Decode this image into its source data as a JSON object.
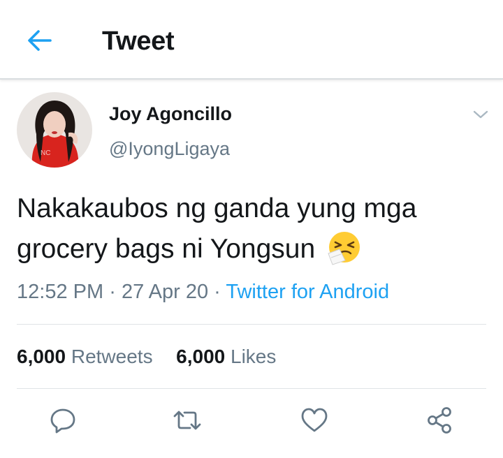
{
  "header": {
    "back_icon": "arrow-left-icon",
    "title": "Tweet"
  },
  "tweet": {
    "author_name": "Joy Agoncillo",
    "author_handle": "@IyongLigaya",
    "text": "Nakakaubos ng ganda yung mga grocery bags ni Yongsun",
    "emoji": "sneezing-face-emoji",
    "time": "12:52 PM",
    "date": "27 Apr 20",
    "separator": "·",
    "source": "Twitter for Android"
  },
  "stats": {
    "retweets_count": "6,000",
    "retweets_label": "Retweets",
    "likes_count": "6,000",
    "likes_label": "Likes"
  },
  "actions": [
    "reply-icon",
    "retweet-icon",
    "like-icon",
    "share-icon"
  ],
  "colors": {
    "accent": "#1da1f2",
    "secondary_text": "#657786",
    "primary_text": "#14171a",
    "divider": "#dfe3e6"
  }
}
